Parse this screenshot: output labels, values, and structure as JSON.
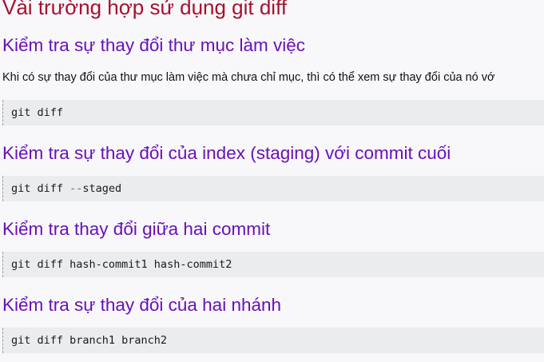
{
  "section_title": "Vài trường hợp sử dụng git diff",
  "subsections": [
    {
      "heading": "Kiểm tra sự thay đổi thư mục làm việc",
      "paragraph": "Khi có sự thay đổi của thư mục làm việc mà chưa chỉ mục, thì có thể xem sự thay đổi của nó vớ",
      "code": "git diff"
    },
    {
      "heading": "Kiểm tra sự thay đổi của index (staging) với commit cuối",
      "code_cmd": "git diff ",
      "code_flag": "--",
      "code_arg": "staged"
    },
    {
      "heading": "Kiểm tra thay đổi giữa hai commit",
      "code": "git diff hash-commit1 hash-commit2"
    },
    {
      "heading": "Kiểm tra sự thay đổi của hai nhánh",
      "code": "git diff branch1 branch2"
    }
  ]
}
